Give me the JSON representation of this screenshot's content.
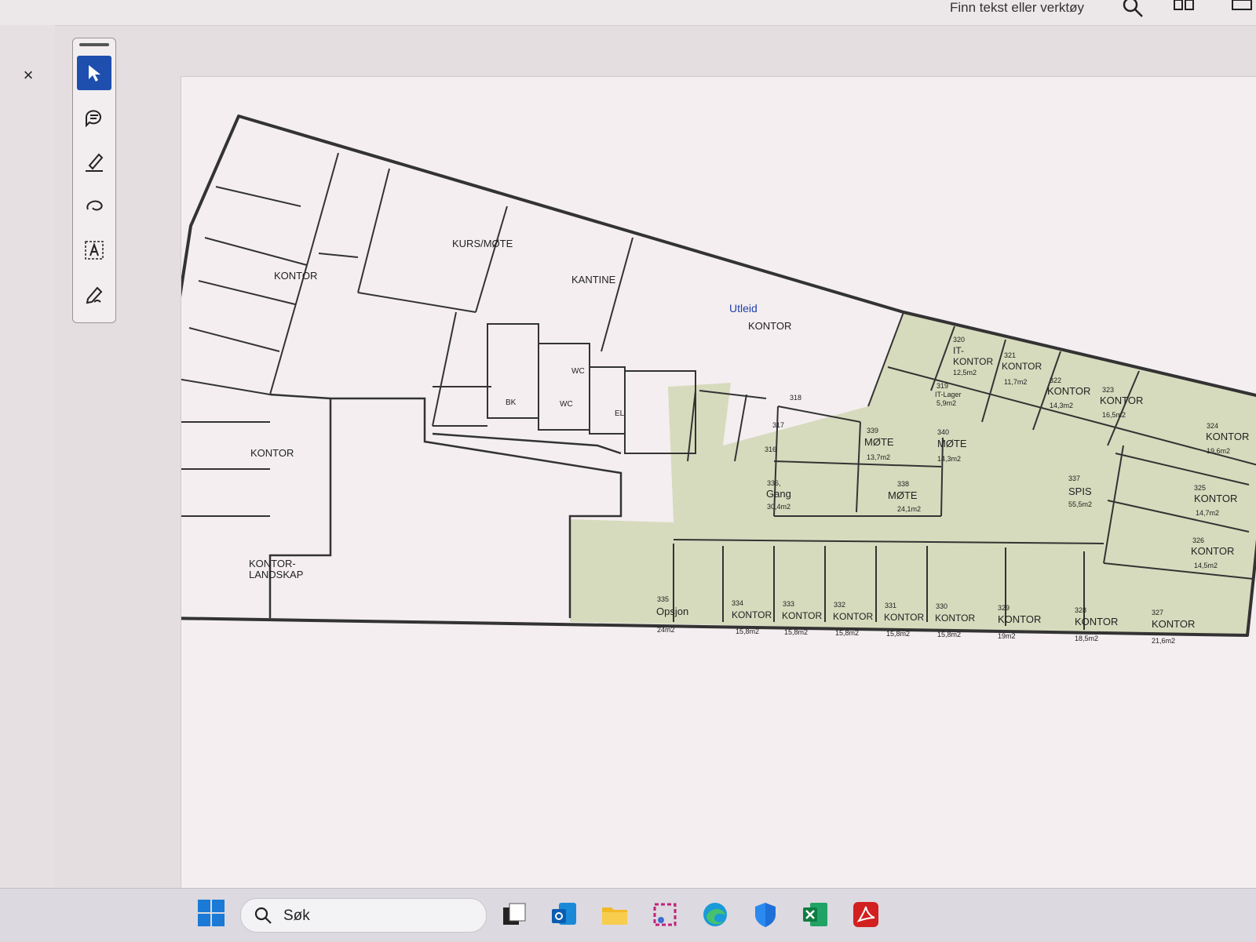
{
  "toolbar_top": {
    "find_text": "Finn tekst eller verktøy"
  },
  "left_panel": {
    "close_glyph": "×"
  },
  "tools": [
    {
      "icon": "pointer-icon",
      "active": true
    },
    {
      "icon": "comment-icon",
      "active": false
    },
    {
      "icon": "highlight-pen-icon",
      "active": false
    },
    {
      "icon": "freehand-draw-icon",
      "active": false
    },
    {
      "icon": "text-box-icon",
      "active": false
    },
    {
      "icon": "sign-pen-icon",
      "active": false
    }
  ],
  "floorplan": {
    "labels": {
      "kurs_mote": "KURS/MØTE",
      "kantine": "KANTINE",
      "kontor_nw": "KONTOR",
      "kontor_w": "KONTOR",
      "kontorlandskap_1": "KONTOR-",
      "kontorlandskap_2": "LANDSKAP",
      "utleid": "Utleid",
      "utleid_kontor": "KONTOR",
      "wc1": "WC",
      "wc2": "WC",
      "bk": "BK",
      "el": "EL"
    },
    "rooms": {
      "r320": {
        "no": "320",
        "name1": "IT-",
        "name2": "KONTOR",
        "area": "12,5m2"
      },
      "r321": {
        "no": "321",
        "name": "KONTOR",
        "area": "11,7m2"
      },
      "r319": {
        "no": "319",
        "name": "IT-Lager",
        "area": "5,9m2"
      },
      "r322": {
        "no": "322",
        "name": "KONTOR",
        "area": "14,3m2"
      },
      "r323": {
        "no": "323",
        "name": "KONTOR",
        "area": "16,5m2"
      },
      "r324": {
        "no": "324",
        "name": "KONTOR",
        "area": "19,6m2"
      },
      "r325": {
        "no": "325",
        "name": "KONTOR",
        "area": "14,7m2"
      },
      "r326": {
        "no": "326",
        "name": "KONTOR",
        "area": "14,5m2"
      },
      "r337": {
        "no": "337",
        "name": "SPIS",
        "area": "55,5m2"
      },
      "r339": {
        "no": "339",
        "name": "MØTE",
        "area": "13,7m2"
      },
      "r340": {
        "no": "340",
        "name": "MØTE",
        "area": "14,3m2"
      },
      "r338": {
        "no": "338",
        "name": "MØTE",
        "area": "24,1m2"
      },
      "r336": {
        "no": "336,",
        "name": "Gang",
        "area": "30,4m2"
      },
      "r318": {
        "no": "318"
      },
      "r317": {
        "no": "317"
      },
      "r316": {
        "no": "316"
      },
      "r335": {
        "no": "335",
        "name": "Opsjon",
        "area": "24m2"
      },
      "r334": {
        "no": "334",
        "name": "KONTOR",
        "area": "15,8m2"
      },
      "r333": {
        "no": "333",
        "name": "KONTOR",
        "area": "15,8m2"
      },
      "r332": {
        "no": "332",
        "name": "KONTOR",
        "area": "15,8m2"
      },
      "r331": {
        "no": "331",
        "name": "KONTOR",
        "area": "15,8m2"
      },
      "r330": {
        "no": "330",
        "name": "KONTOR",
        "area": "15,8m2"
      },
      "r329": {
        "no": "329",
        "name": "KONTOR",
        "area": "19m2"
      },
      "r328": {
        "no": "328",
        "name": "KONTOR",
        "area": "18,5m2"
      },
      "r327": {
        "no": "327",
        "name": "KONTOR",
        "area": "21,6m2"
      }
    }
  },
  "taskbar": {
    "search_placeholder": "Søk",
    "apps": [
      "task-view-icon",
      "outlook-icon",
      "file-explorer-icon",
      "snipping-tool-icon",
      "edge-icon",
      "defender-icon",
      "excel-icon",
      "acrobat-icon"
    ]
  },
  "colors": {
    "accent": "#1f4fae",
    "shaded_room": "#d7dbbd",
    "wall": "#333333",
    "utleid": "#1f3fb0",
    "page": "#f4eef0"
  }
}
